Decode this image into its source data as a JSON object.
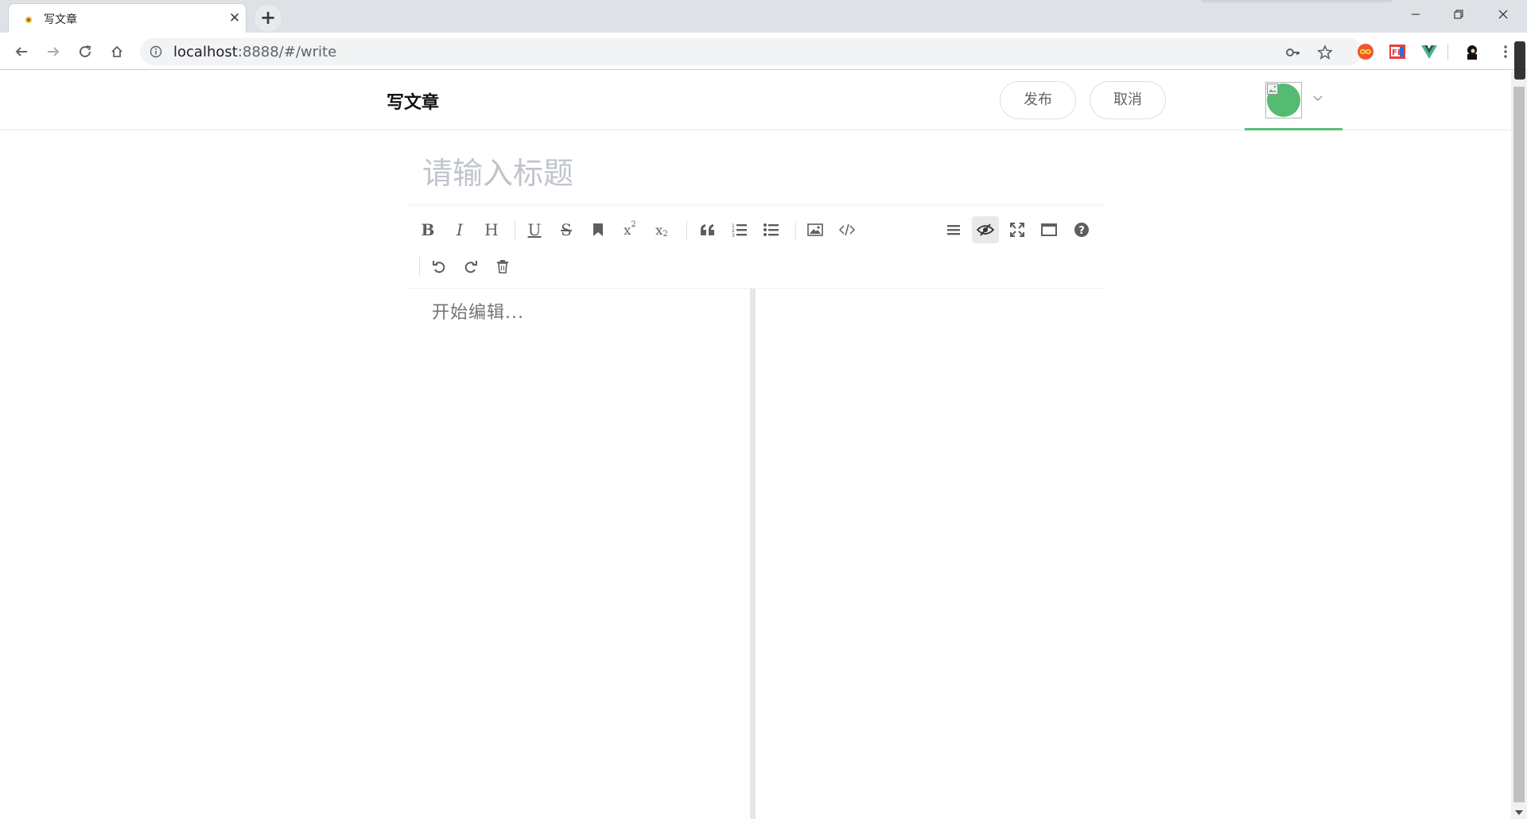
{
  "browser": {
    "tab_title": "写文章",
    "new_tab_icon": "plus-icon",
    "url_host": "localhost",
    "url_path": ":8888/#/write",
    "window_controls": [
      "minimize-icon",
      "restore-icon",
      "close-icon"
    ],
    "extensions": [
      "key-icon",
      "star-icon",
      "infinity-extension-icon",
      "fe-extension-icon",
      "vue-devtools-icon",
      "profile-avatar-icon",
      "menu-icon"
    ]
  },
  "header": {
    "title": "写文章",
    "publish_label": "发布",
    "cancel_label": "取消",
    "accent_color": "#5cbf76"
  },
  "editor": {
    "title_placeholder": "请输入标题",
    "content_placeholder": "开始编辑...",
    "toolbar_left": [
      "bold-icon",
      "italic-icon",
      "heading-icon",
      "underline-icon",
      "strikethrough-icon",
      "mark-icon",
      "superscript-icon",
      "subscript-icon",
      "quote-icon",
      "ordered-list-icon",
      "unordered-list-icon",
      "image-icon",
      "code-icon"
    ],
    "toolbar_right": [
      "navigation-icon",
      "preview-toggle-icon",
      "fullscreen-icon",
      "read-mode-icon",
      "help-icon"
    ],
    "toolbar_row2": [
      "undo-icon",
      "redo-icon",
      "trash-icon"
    ],
    "active_tool": "preview-toggle-icon"
  }
}
